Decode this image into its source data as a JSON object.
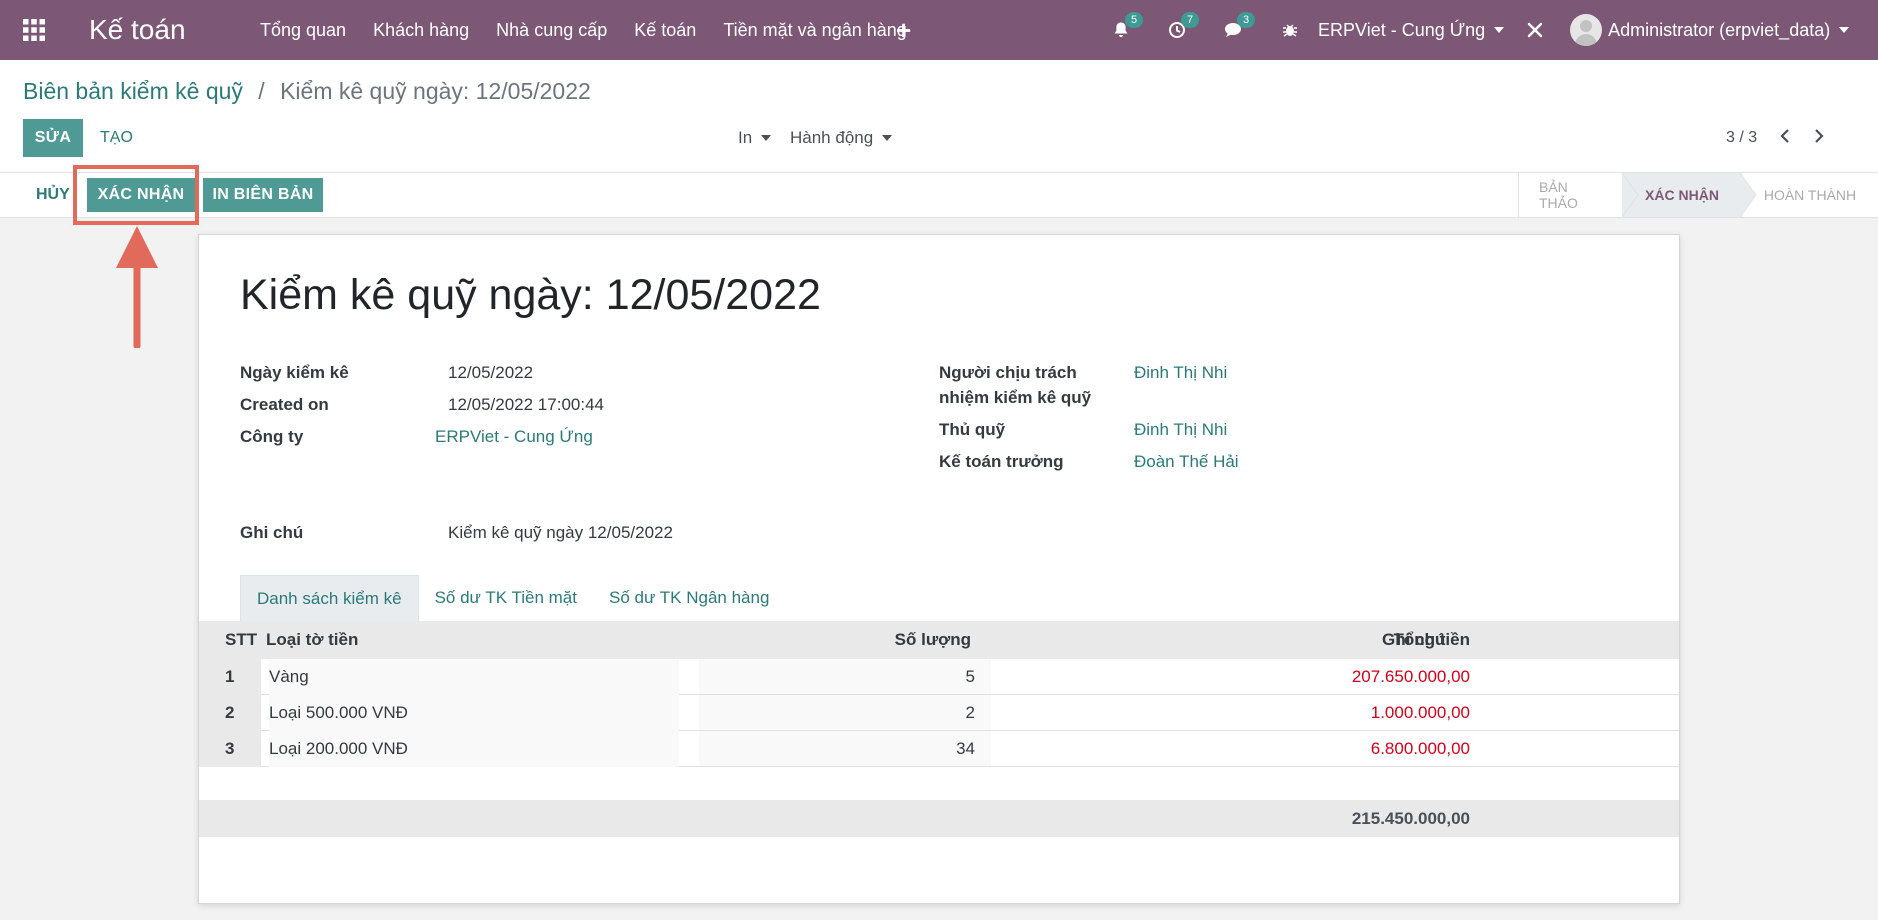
{
  "navbar": {
    "app_title": "Kế toán",
    "menu": [
      "Tổng quan",
      "Khách hàng",
      "Nhà cung cấp",
      "Kế toán",
      "Tiền mặt và ngân hàng"
    ],
    "plus": "+",
    "notifications_count": "5",
    "activities_count": "7",
    "messages_count": "3",
    "company": "ERPViet - Cung Ứng",
    "user": "Administrator (erpviet_data)",
    "bg_color": "#7c5876"
  },
  "breadcrumb": {
    "parent": "Biên bản kiểm kê quỹ",
    "separator": "/",
    "current": "Kiểm kê quỹ ngày: 12/05/2022"
  },
  "control_panel": {
    "edit_label": "SỬA",
    "create_label": "TẠO",
    "print_label": "In",
    "action_label": "Hành động",
    "pager": "3 / 3"
  },
  "statusbar": {
    "cancel_label": "HỦY",
    "confirm_label": "XÁC NHẬN",
    "print_report_label": "IN BIÊN BẢN",
    "stages": [
      "BẢN THẢO",
      "XÁC NHẬN",
      "HOÀN THÀNH"
    ],
    "active_stage": "XÁC NHẬN"
  },
  "record": {
    "title": "Kiểm kê quỹ ngày: 12/05/2022",
    "fields_left": [
      {
        "label": "Ngày kiểm kê",
        "value": "12/05/2022"
      },
      {
        "label": "Created on",
        "value": "12/05/2022 17:00:44"
      },
      {
        "label": "Công ty",
        "value": "ERPViet - Cung Ứng"
      }
    ],
    "fields_right": [
      {
        "label": "Người chịu trách nhiệm kiểm kê quỹ",
        "value": "Đinh Thị Nhi"
      },
      {
        "label": "Thủ quỹ",
        "value": "Đinh Thị Nhi"
      },
      {
        "label": "Kế toán trưởng",
        "value": "Đoàn Thế Hải"
      }
    ],
    "note_label": "Ghi chú",
    "note_value": "Kiểm kê quỹ ngày 12/05/2022"
  },
  "tabs": [
    "Danh sách kiểm kê",
    "Số dư TK Tiền mặt",
    "Số dư TK Ngân hàng"
  ],
  "table": {
    "headers": {
      "stt": "STT",
      "type": "Loại tờ tiền",
      "qty": "Số lượng",
      "total": "Tổng tiền",
      "note": "Ghi chú"
    },
    "rows": [
      {
        "stt": "1",
        "type": "Vàng",
        "qty": "5",
        "total": "207.650.000,00"
      },
      {
        "stt": "2",
        "type": "Loại 500.000 VNĐ",
        "qty": "2",
        "total": "1.000.000,00"
      },
      {
        "stt": "3",
        "type": "Loại 200.000 VNĐ",
        "qty": "34",
        "total": "6.800.000,00"
      }
    ],
    "grand_total": "215.450.000,00"
  },
  "accent_color": "#4f9a94",
  "annotation_color": "#e26a5a"
}
